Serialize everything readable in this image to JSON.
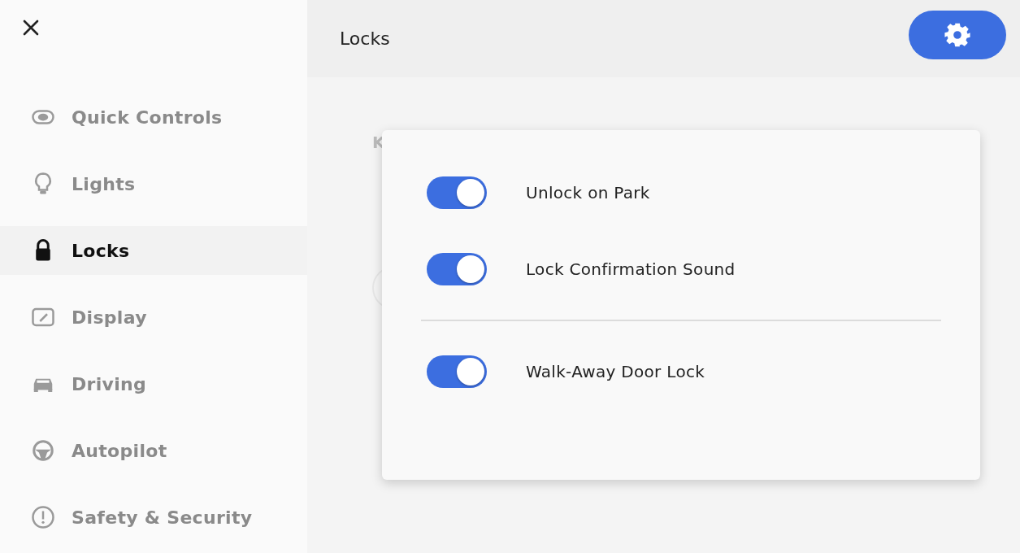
{
  "sidebar": {
    "items": [
      {
        "label": "Quick Controls",
        "kind": "toggle",
        "selected": false
      },
      {
        "label": "Lights",
        "kind": "bulb",
        "selected": false
      },
      {
        "label": "Locks",
        "kind": "lock",
        "selected": true
      },
      {
        "label": "Display",
        "kind": "display",
        "selected": false
      },
      {
        "label": "Driving",
        "kind": "car",
        "selected": false
      },
      {
        "label": "Autopilot",
        "kind": "wheel",
        "selected": false
      },
      {
        "label": "Safety & Security",
        "kind": "alert",
        "selected": false
      }
    ]
  },
  "header": {
    "title": "Locks"
  },
  "background_section": {
    "heading": "K"
  },
  "popup": {
    "groups": [
      [
        {
          "label": "Unlock on Park",
          "on": true
        },
        {
          "label": "Lock Confirmation Sound",
          "on": true
        }
      ],
      [
        {
          "label": "Walk-Away Door Lock",
          "on": true
        }
      ]
    ]
  }
}
